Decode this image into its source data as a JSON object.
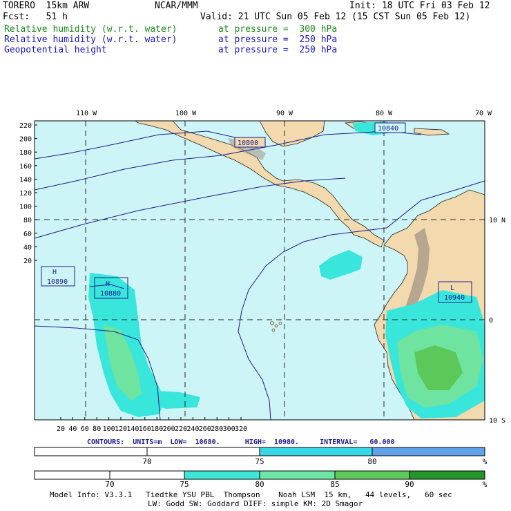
{
  "header": {
    "model": "TORERO  15km ARW",
    "center": "NCAR/MMM",
    "init": "Init: 18 UTC Fri 03 Feb 12",
    "fcst": "Fcst:   51 h",
    "valid": "Valid: 21 UTC Sun 05 Feb 12 (15 CST Sun 05 Feb 12)",
    "fields": [
      {
        "name": "Relative humidity (w.r.t. water)",
        "level": "at pressure =  300 hPa",
        "color": "#1a8a1a"
      },
      {
        "name": "Relative humidity (w.r.t. water)",
        "level": "at pressure =  250 hPa",
        "color": "#1515c8"
      },
      {
        "name": "Geopotential height",
        "level": "at pressure =  250 hPa",
        "color": "#1515c8"
      }
    ]
  },
  "map": {
    "lon_labels": [
      "110 W",
      "100 W",
      "90 W",
      "80 W",
      "70 W"
    ],
    "lat_labels": [
      "10 N",
      "0",
      "10 S"
    ],
    "y_ticks": [
      "220",
      "200",
      "180",
      "160",
      "140",
      "120",
      "100",
      "80",
      "60",
      "40",
      "20"
    ],
    "x_ticks": [
      "20",
      "40",
      "60",
      "80",
      "100",
      "120",
      "140",
      "160",
      "180",
      "200",
      "220",
      "240",
      "260",
      "280",
      "300",
      "320"
    ],
    "centers": [
      {
        "type": "H",
        "value": "10890"
      },
      {
        "type": "H",
        "value": "10880"
      },
      {
        "type": "L",
        "value": "10940"
      }
    ],
    "contour_labels": [
      "10800",
      "10840"
    ],
    "colors": {
      "ocean": "#cdf5f7",
      "land": "#f2d9ae",
      "contour": "#1c1c8a",
      "rh_low": "#39e6dc",
      "rh_mid": "#6fe3a0"
    }
  },
  "contours_info": {
    "text": "CONTOURS:  UNITS=m  LOW=  10680.      HIGH=  10980.     INTERVAL=   60.000"
  },
  "colorbar1": {
    "labels": [
      "70",
      "75",
      "80"
    ],
    "unit": "%",
    "colors": [
      "#ffffff",
      "#ffffff",
      "#39d8e8",
      "#5fa2ea"
    ]
  },
  "colorbar2": {
    "labels": [
      "70",
      "75",
      "80",
      "85",
      "90"
    ],
    "unit": "%",
    "colors": [
      "#ffffff",
      "#ffffff",
      "#3ee6d8",
      "#6ee6a6",
      "#5cc85a",
      "#22962a"
    ]
  },
  "footer": {
    "line1": "Model Info: V3.3.1   Tiedtke YSU PBL  Thompson    Noah LSM  15 km,   44 levels,   60 sec",
    "line2": "LW: Godd SW: Goddard DIFF: simple KM: 2D Smagor"
  }
}
